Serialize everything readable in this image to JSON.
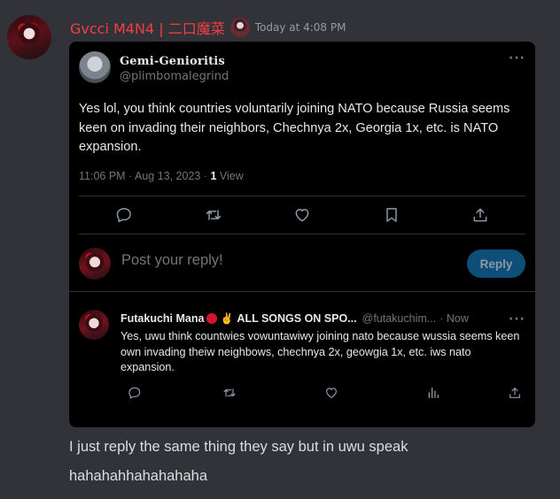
{
  "message": {
    "username": "Gvcci M4N4 | 二口魔菜",
    "timestamp": "Today at 4:08 PM",
    "text_line1": "I just reply the same thing they say but in uwu speak",
    "text_line2": "hahahahhahahahaha"
  },
  "tweet": {
    "display_name": "Gemi-Genioritis",
    "handle": "@plimbomalegrind",
    "text": "Yes lol, you think countries voluntarily joining NATO because Russia seems keen on invading their neighbors, Chechnya 2x, Georgia 1x, etc. is NATO expansion.",
    "date": "11:06 PM · Aug 13, 2023 · ",
    "views_count": "1",
    "views_label": " View",
    "more": "···"
  },
  "reply_box": {
    "placeholder": "Post your reply!",
    "button_label": "Reply"
  },
  "reply": {
    "display_name": "Futakuchi Mana",
    "name_suffix": "ALL SONGS ON SPO...",
    "handle": "@futakuchim...",
    "time": "· Now",
    "text": "Yes, uwu think countwies vowuntawiwy joining nato because wussia seems keen own invading theiw neighbows, chechnya 2x, geowgia 1x, etc. iws nato expansion.",
    "more": "···"
  },
  "icons": [
    "reply-icon",
    "retweet-icon",
    "like-icon",
    "bookmark-icon",
    "share-icon",
    "views-icon"
  ],
  "colors": {
    "username": "#f23f42",
    "background": "#313338",
    "embed_background": "#000000",
    "reply_button": "#0f4e78",
    "muted_text": "#71767b"
  }
}
